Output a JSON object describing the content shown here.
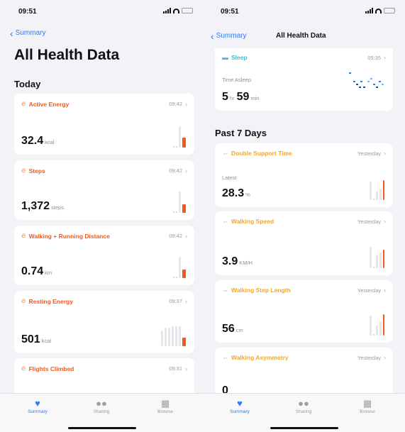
{
  "colors": {
    "accent": "#2f7cf6",
    "activity": "#f05a1a",
    "mobility": "#f6a623",
    "sleep": "#36c2d1"
  },
  "left": {
    "status_time": "09:51",
    "back_label": "Summary",
    "title": "All Health Data",
    "section": "Today",
    "cards": [
      {
        "label": "Active Energy",
        "time": "09:42",
        "value": "32.4",
        "unit": "kcal",
        "icon": "flame-icon"
      },
      {
        "label": "Steps",
        "time": "09:42",
        "value": "1,372",
        "unit": "steps",
        "icon": "flame-icon"
      },
      {
        "label": "Walking + Running Distance",
        "time": "09:42",
        "value": "0.74",
        "unit": "km",
        "icon": "flame-icon"
      },
      {
        "label": "Resting Energy",
        "time": "09:37",
        "value": "501",
        "unit": "kcal",
        "icon": "flame-icon"
      },
      {
        "label": "Flights Climbed",
        "time": "09:31",
        "icon": "flame-icon"
      }
    ],
    "tabs": [
      {
        "label": "Summary",
        "icon": "heart-icon"
      },
      {
        "label": "Sharing",
        "icon": "people-icon"
      },
      {
        "label": "Browse",
        "icon": "grid-icon"
      }
    ]
  },
  "right": {
    "status_time": "09:51",
    "back_label": "Summary",
    "nav_title": "All Health Data",
    "sleep": {
      "label": "Sleep",
      "time": "05:35",
      "sub": "Time Asleep",
      "hours": "5",
      "hr_unit": "hr",
      "minutes": "59",
      "min_unit": "min",
      "icon": "bed-icon"
    },
    "section": "Past 7 Days",
    "cards": [
      {
        "label": "Double Support Time",
        "time": "Yesterday",
        "sub": "Latest",
        "value": "28.3",
        "unit": "%",
        "icon": "walking-icon"
      },
      {
        "label": "Walking Speed",
        "time": "Yesterday",
        "value": "3.9",
        "unit": "KM/H",
        "icon": "walking-icon"
      },
      {
        "label": "Walking Step Length",
        "time": "Yesterday",
        "value": "56",
        "unit": "cm",
        "icon": "walking-icon"
      },
      {
        "label": "Walking Asymmetry",
        "time": "Yesterday",
        "value": "0",
        "icon": "walking-icon"
      }
    ],
    "tabs": [
      {
        "label": "Summary",
        "icon": "heart-icon"
      },
      {
        "label": "Sharing",
        "icon": "people-icon"
      },
      {
        "label": "Browse",
        "icon": "grid-icon"
      }
    ]
  }
}
